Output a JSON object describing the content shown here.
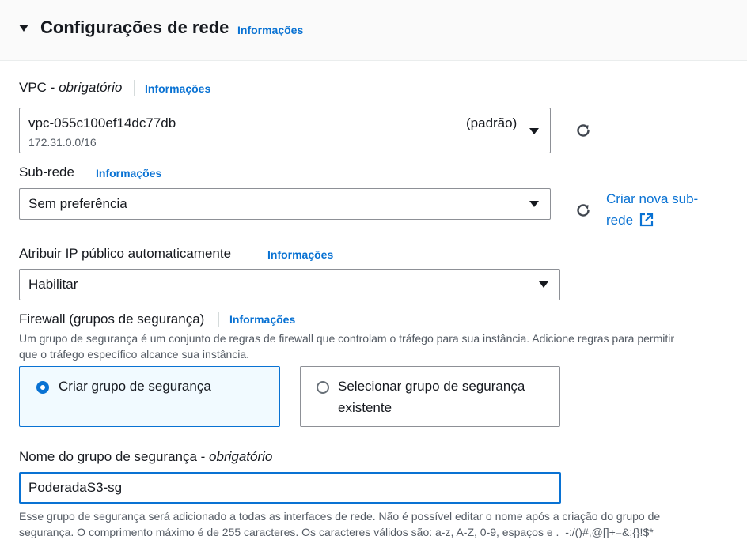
{
  "section": {
    "title": "Configurações de rede",
    "info_link": "Informações"
  },
  "vpc": {
    "label": "VPC - ",
    "required": "obrigatório",
    "info_link": "Informações",
    "value": "vpc-055c100ef14dc77db",
    "tag": "(padrão)",
    "cidr": "172.31.0.0/16"
  },
  "subnet": {
    "label": "Sub-rede",
    "info_link": "Informações",
    "value": "Sem preferência",
    "create_link_line1": "Criar nova sub-",
    "create_link_line2": "rede"
  },
  "public_ip": {
    "label": "Atribuir IP público automaticamente",
    "info_link": "Informações",
    "value": "Habilitar"
  },
  "firewall": {
    "label": "Firewall (grupos de segurança)",
    "info_link": "Informações",
    "description_line1": "Um grupo de segurança é um conjunto de regras de firewall que controlam o tráfego para sua instância. Adicione regras para permitir",
    "description_line2": "que o tráfego específico alcance sua instância.",
    "options": [
      {
        "label": "Criar grupo de segurança",
        "selected": true
      },
      {
        "label_line1": "Selecionar grupo de segurança",
        "label_line2": "existente",
        "selected": false
      }
    ]
  },
  "sg_name": {
    "label": "Nome do grupo de segurança - ",
    "required": "obrigatório",
    "value": "PoderadaS3-sg",
    "help_line1": "Esse grupo de segurança será adicionado a todas as interfaces de rede. Não é possível editar o nome após a criação do grupo de",
    "help_line2": "segurança. O comprimento máximo é de 255 caracteres. Os caracteres válidos são: a-z, A-Z, 0-9, espaços e ._-:/()#,@[]+=&;{}!$*"
  },
  "colors": {
    "accent": "#0972d3",
    "text": "#16191f",
    "muted": "#545b64",
    "selected_tile_bg": "#f1faff",
    "border": "#8d9096"
  },
  "icons": {
    "refresh": "refresh-icon",
    "external": "external-link-icon",
    "caret": "caret-down-icon"
  }
}
